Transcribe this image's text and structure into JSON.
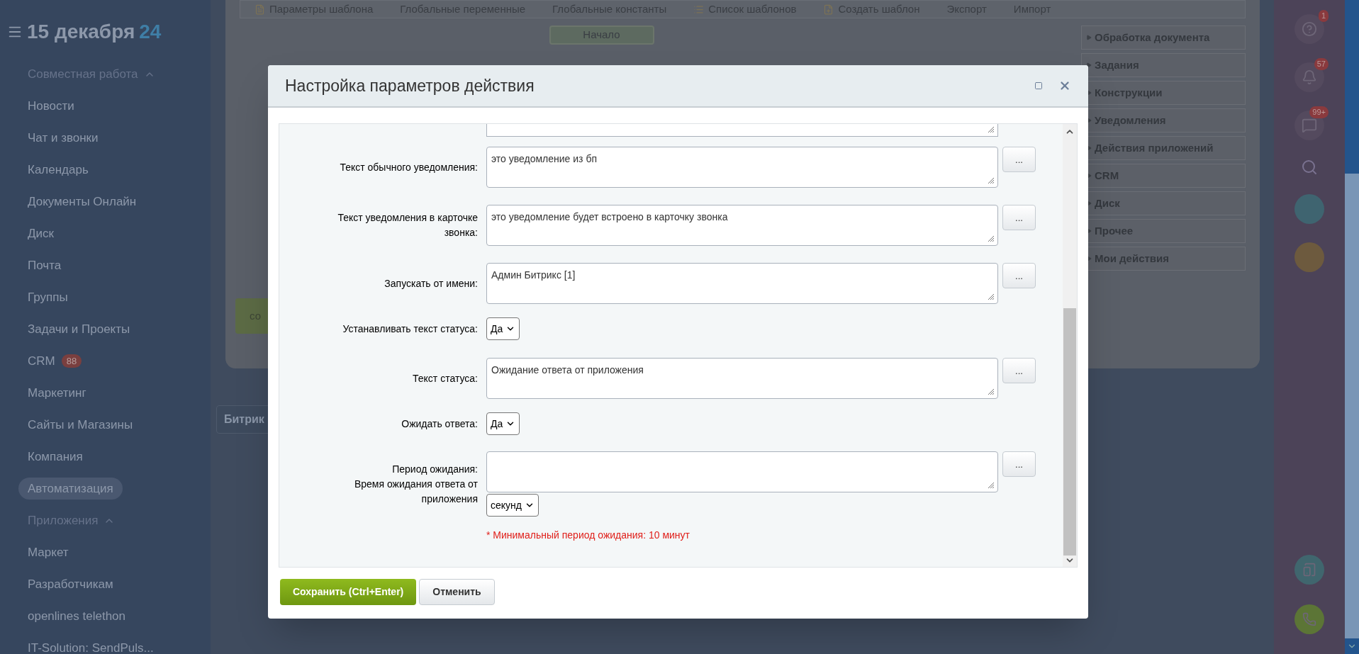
{
  "sidebar": {
    "date": "15 декабря",
    "year": "24",
    "items": [
      {
        "kind": "section",
        "label": "Совместная работа",
        "expanded": true,
        "selected": false
      },
      {
        "kind": "item",
        "label": "Новости",
        "selected": false
      },
      {
        "kind": "item",
        "label": "Чат и звонки",
        "selected": false
      },
      {
        "kind": "item",
        "label": "Календарь",
        "selected": false
      },
      {
        "kind": "item",
        "label": "Документы Онлайн",
        "selected": false
      },
      {
        "kind": "item",
        "label": "Диск",
        "selected": false
      },
      {
        "kind": "item",
        "label": "Почта",
        "selected": false
      },
      {
        "kind": "item",
        "label": "Группы",
        "selected": false
      },
      {
        "kind": "item",
        "label": "Задачи и Проекты",
        "selected": false
      },
      {
        "kind": "item",
        "label": "CRM",
        "counter": "88",
        "selected": false
      },
      {
        "kind": "item",
        "label": "Маркетинг",
        "selected": false
      },
      {
        "kind": "item",
        "label": "Сайты и Магазины",
        "selected": false
      },
      {
        "kind": "item",
        "label": "Компания",
        "selected": false
      },
      {
        "kind": "item",
        "label": "Автоматизация",
        "selected": true
      },
      {
        "kind": "section",
        "label": "Приложения",
        "expanded": true,
        "selected": false
      },
      {
        "kind": "item",
        "label": "Маркет",
        "selected": false
      },
      {
        "kind": "item",
        "label": "Разработчикам",
        "selected": false
      },
      {
        "kind": "item",
        "label": "openlines telethon",
        "selected": false
      },
      {
        "kind": "item",
        "label": "IT-Solution: SendPuls...",
        "selected": false
      }
    ]
  },
  "toolbar": [
    {
      "label": "Параметры шаблона",
      "has_icon": true
    },
    {
      "label": "Глобальные переменные",
      "has_icon": false
    },
    {
      "label": "Глобальные константы",
      "has_icon": false
    },
    {
      "label": "Список шаблонов",
      "has_icon": true
    },
    {
      "label": "Создать шаблон",
      "has_icon": true
    },
    {
      "label": "Экспорт",
      "has_icon": false
    },
    {
      "label": "Импорт",
      "has_icon": false
    }
  ],
  "canvas": {
    "start_node": "Начало",
    "save_button": "со",
    "bottom_tab": "Битрик"
  },
  "activities": [
    "Обработка документа",
    "Задания",
    "Конструкции",
    "Уведомления",
    "Действия приложений",
    "CRM",
    "Диск",
    "Прочее",
    "Мои действия"
  ],
  "right_rail": {
    "help_badge": "1",
    "bell_badge": "57",
    "chat_badge": "99+"
  },
  "dialog": {
    "title": "Настройка параметров действия",
    "fields": [
      {
        "kind": "textarea",
        "label": "Текст обычного уведомления:",
        "value": "это уведомление из бп",
        "picker": "..."
      },
      {
        "kind": "textarea",
        "label": "Текст уведомления в карточке звонка:",
        "value": "это уведомление будет встроено в карточку звонка",
        "picker": "..."
      },
      {
        "kind": "textarea",
        "label": "Запускать от имени:",
        "value": "Админ Битрикс [1]",
        "picker": "..."
      },
      {
        "kind": "select",
        "label": "Устанавливать текст статуса:",
        "value": "Да"
      },
      {
        "kind": "textarea",
        "label": "Текст статуса:",
        "value": "Ожидание ответа от приложения",
        "picker": "..."
      },
      {
        "kind": "select",
        "label": "Ожидать ответа:",
        "value": "Да"
      },
      {
        "kind": "period",
        "label": "Период ожидания:",
        "hint": "Время ожидания ответа от приложения",
        "picker": "...",
        "unit": "секунд",
        "note": "* Минимальный период ожидания: 10 минут"
      }
    ],
    "buttons": [
      {
        "kind": "primary",
        "label": "Сохранить (Ctrl+Enter)"
      },
      {
        "kind": "secondary",
        "label": "Отменить"
      }
    ]
  }
}
